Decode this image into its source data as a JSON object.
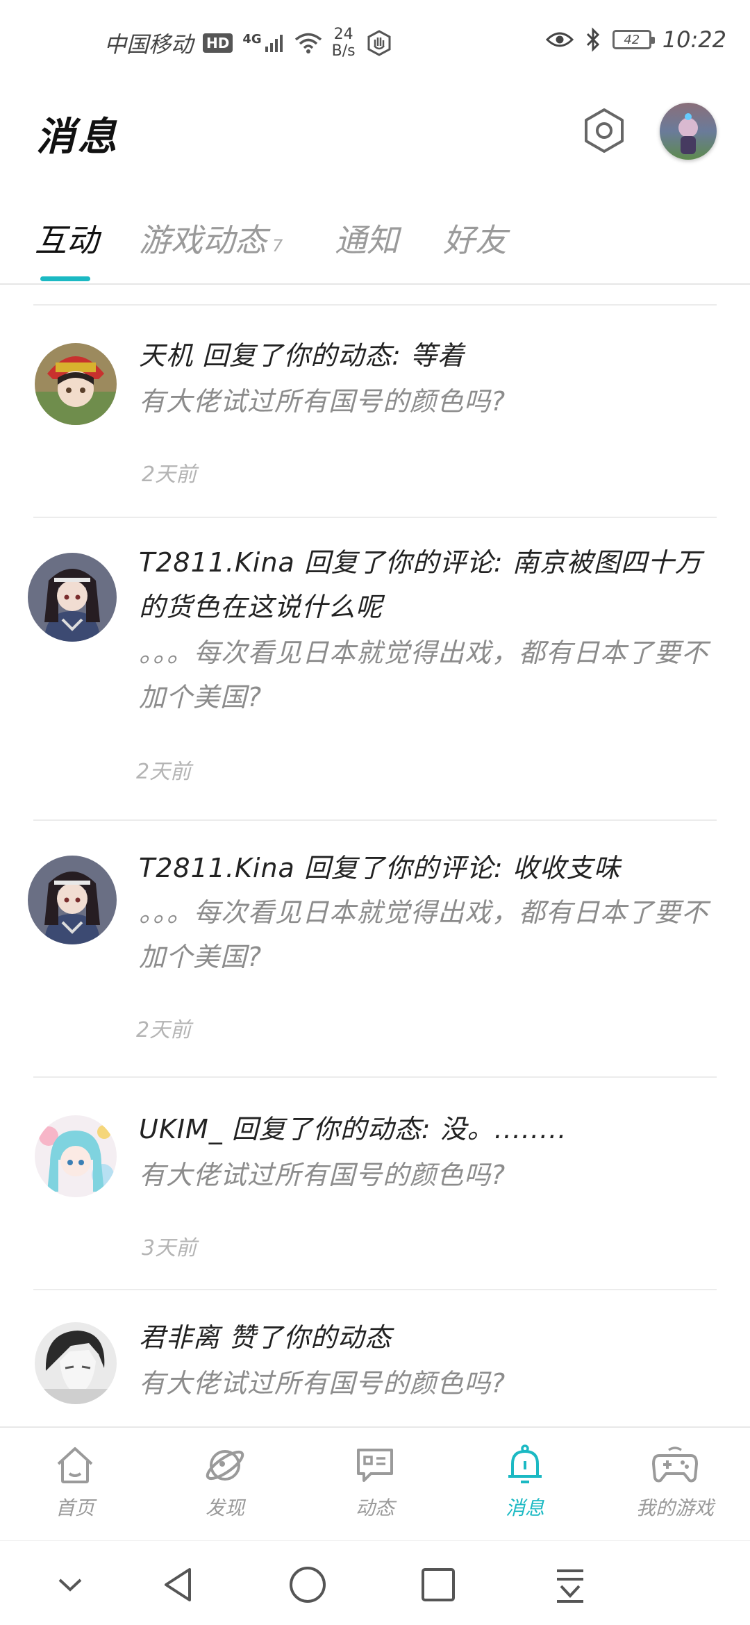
{
  "status_bar": {
    "carrier": "中国移动",
    "hd": "HD",
    "network": "4G",
    "speed_value": "24",
    "speed_unit": "B/s",
    "battery": "42",
    "time": "10:22"
  },
  "header": {
    "title": "消息"
  },
  "tabs": [
    {
      "label": "互动",
      "active": true
    },
    {
      "label": "游戏动态",
      "badge": "7"
    },
    {
      "label": "通知"
    },
    {
      "label": "好友"
    }
  ],
  "messages": [
    {
      "title": "天机 回复了你的动态: 等着",
      "quote": "有大佬试过所有国号的颜色吗?",
      "time": "2天前"
    },
    {
      "title": "T2811.Kina 回复了你的评论: 南京被图四十万的货色在这说什么呢",
      "quote": "。。。每次看见日本就觉得出戏，都有日本了要不加个美国?",
      "time": "2天前"
    },
    {
      "title": "T2811.Kina 回复了你的评论: 收收支味",
      "quote": "。。。每次看见日本就觉得出戏，都有日本了要不加个美国?",
      "time": "2天前"
    },
    {
      "title": "UKIM_ 回复了你的动态: 没。........",
      "quote": "有大佬试过所有国号的颜色吗?",
      "time": "3天前"
    },
    {
      "title": "君非离 赞了你的动态",
      "quote": "有大佬试过所有国号的颜色吗?",
      "time": ""
    }
  ],
  "bottom_nav": [
    {
      "label": "首页",
      "icon": "home-icon"
    },
    {
      "label": "发现",
      "icon": "planet-icon"
    },
    {
      "label": "动态",
      "icon": "chat-icon"
    },
    {
      "label": "消息",
      "icon": "bell-icon",
      "active": true
    },
    {
      "label": "我的游戏",
      "icon": "gamepad-icon"
    }
  ],
  "colors": {
    "accent": "#1bb9c3",
    "inactive": "#9a9a9a"
  }
}
